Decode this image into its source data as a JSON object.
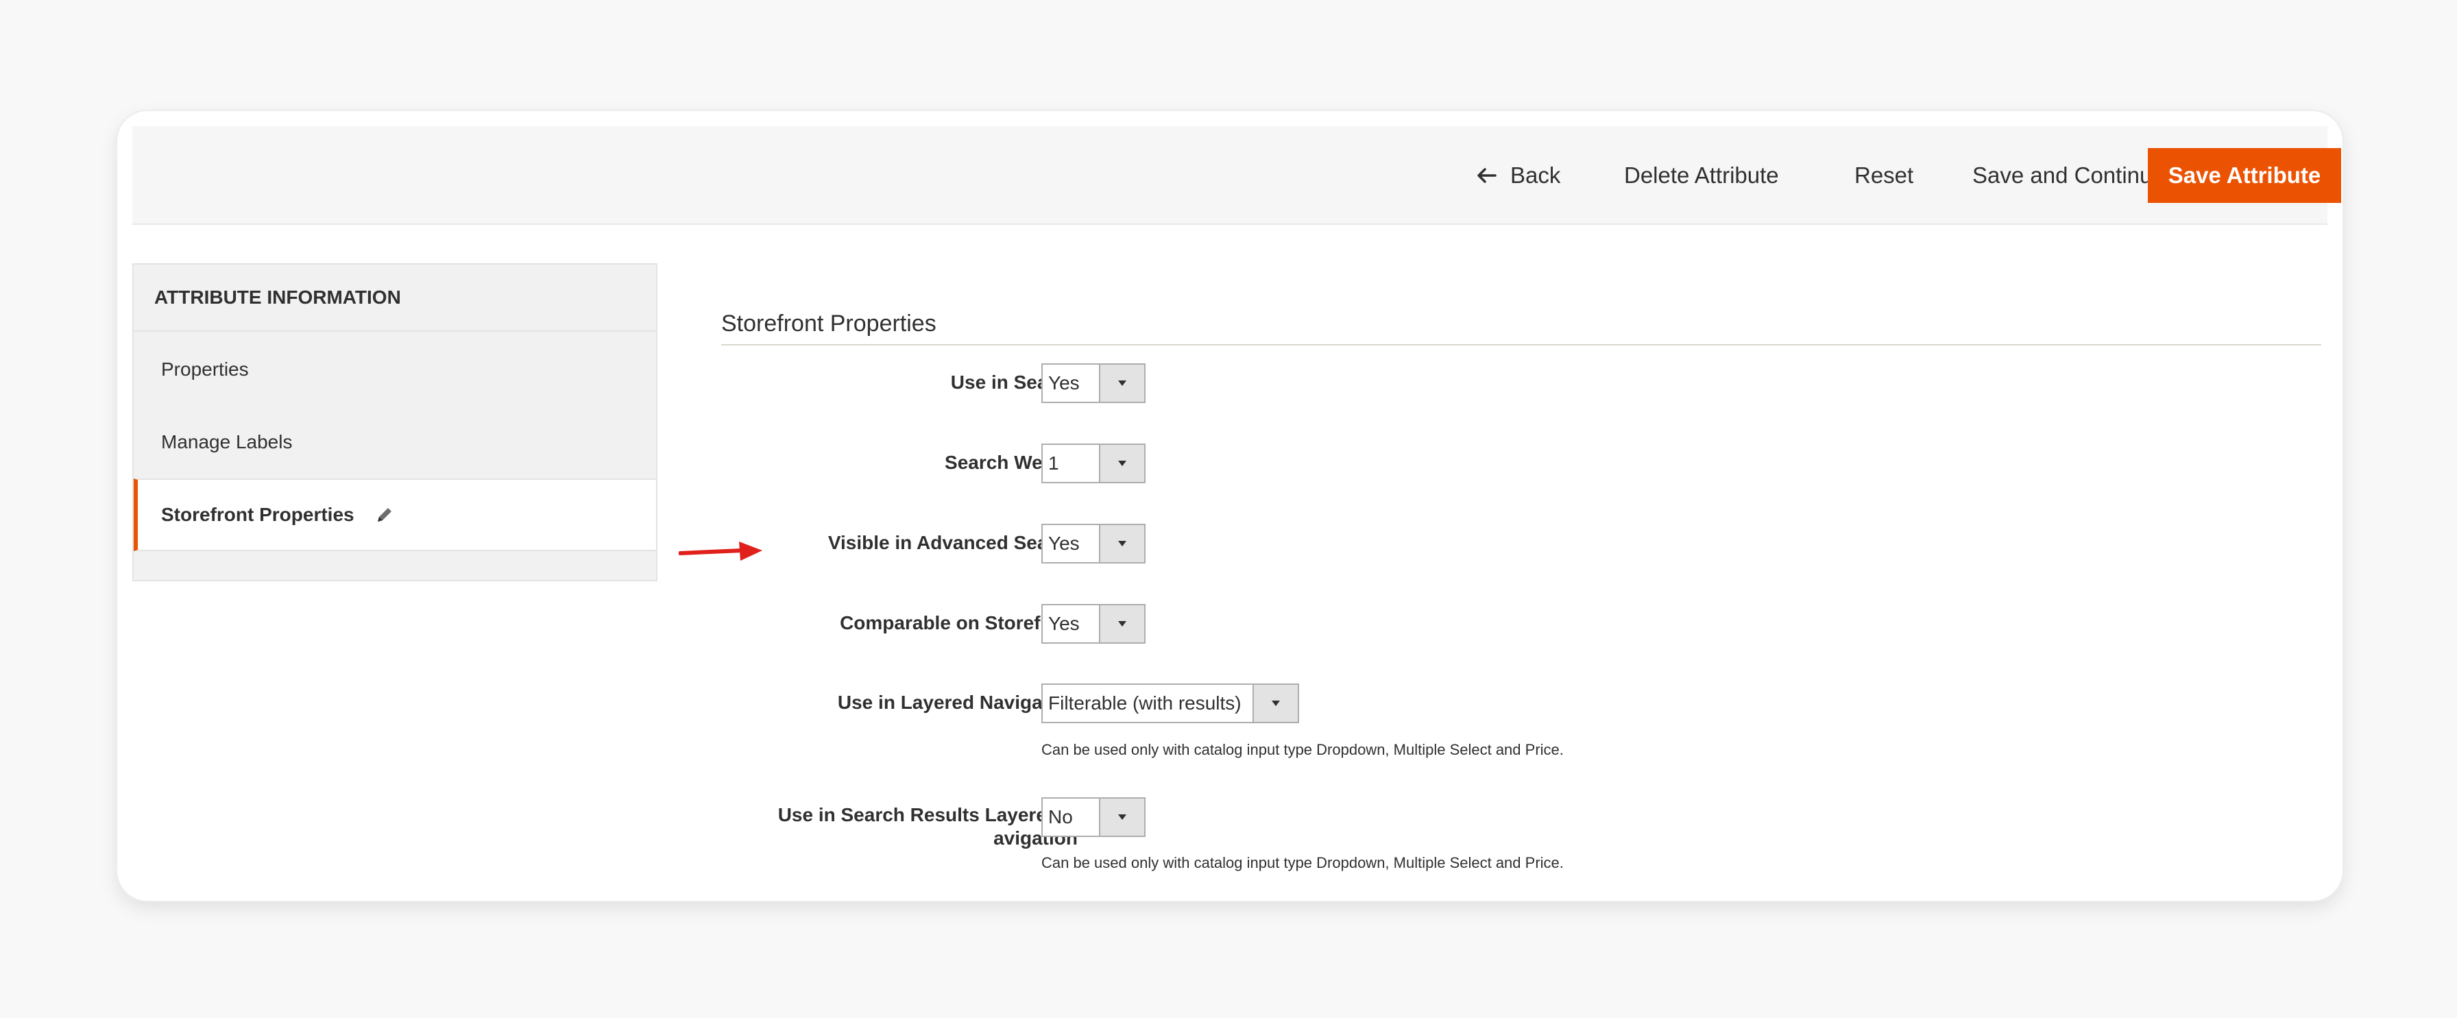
{
  "actions": {
    "back_label": "Back",
    "delete_label": "Delete Attribute",
    "reset_label": "Reset",
    "save_continue_label": "Save and Continue Edit",
    "save_label": "Save Attribute"
  },
  "sidebar": {
    "title": "ATTRIBUTE INFORMATION",
    "items": [
      {
        "label": "Properties"
      },
      {
        "label": "Manage Labels"
      },
      {
        "label": "Storefront Properties"
      }
    ]
  },
  "section": {
    "title": "Storefront Properties"
  },
  "fields": [
    {
      "label": "Use in Search",
      "value": "Yes"
    },
    {
      "label": "Search Weight",
      "value": "1"
    },
    {
      "label": "Visible in Advanced Search",
      "value": "Yes"
    },
    {
      "label": "Comparable on Storefront",
      "value": "Yes"
    },
    {
      "label": "Use in Layered Navigation",
      "value": "Filterable (with results)",
      "note": "Can be used only with catalog input type Dropdown, Multiple Select and Price."
    },
    {
      "label_line1": "Use in Search Results Layered N",
      "label_line2": "avigation",
      "value": "No",
      "note": "Can be used only with catalog input type Dropdown, Multiple Select and Price."
    }
  ],
  "colors": {
    "accent": "#eb5202",
    "annotation_arrow": "#e0201b"
  }
}
